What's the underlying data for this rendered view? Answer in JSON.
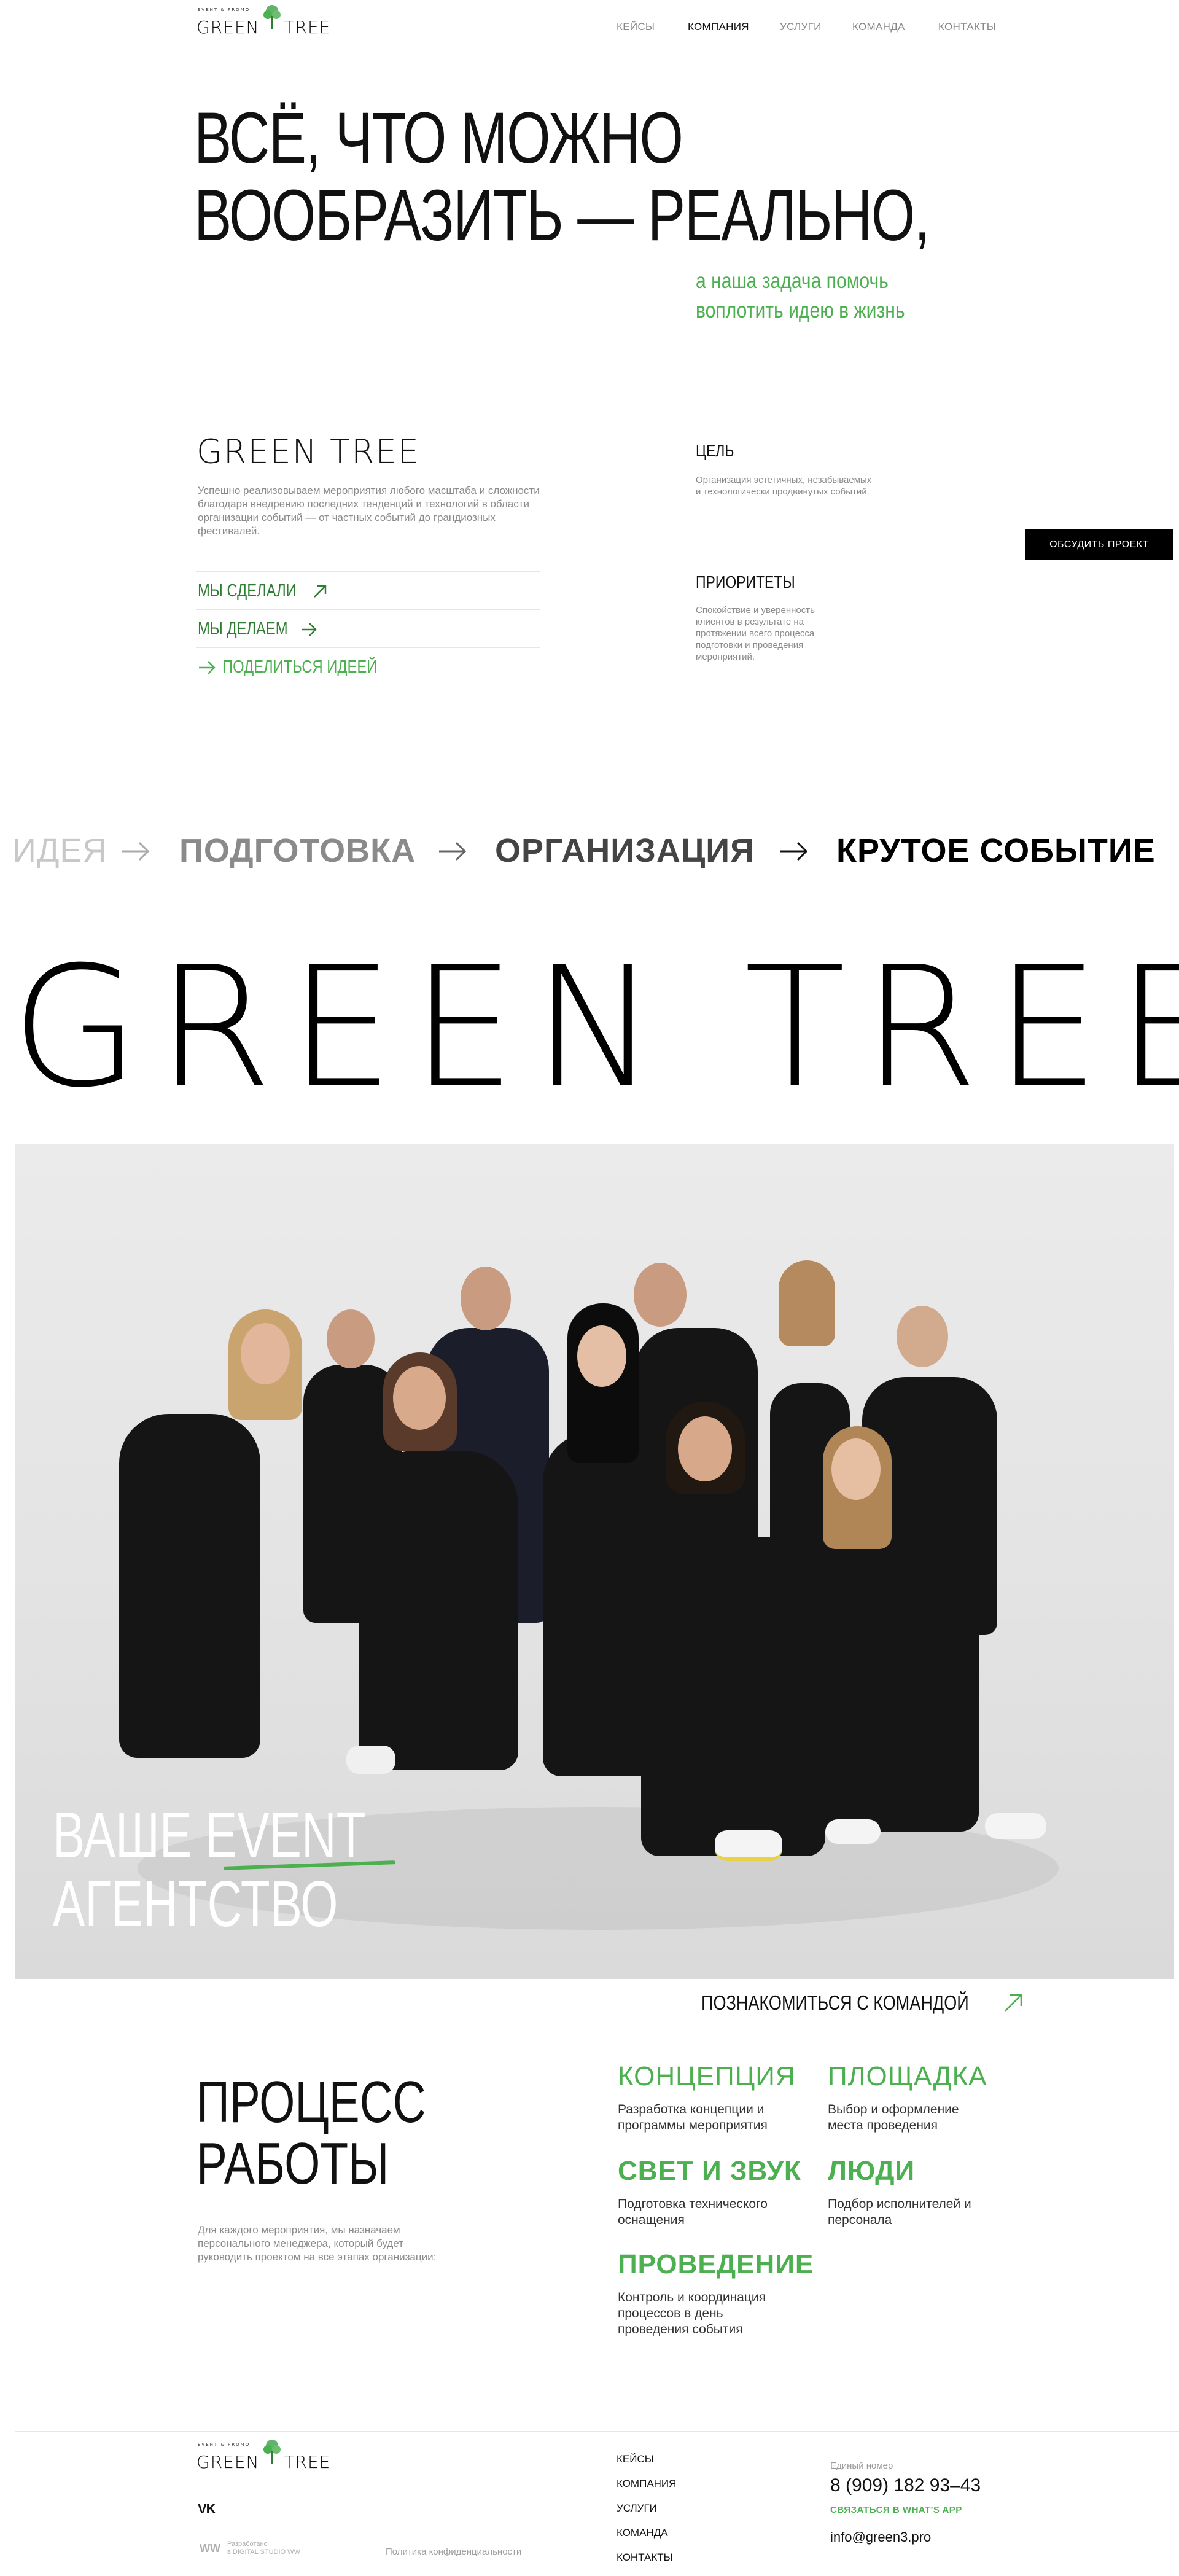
{
  "header": {
    "logo_small": "EVENT & PROMO",
    "logo_text": "GREEN TREE",
    "nav": [
      "КЕЙСЫ",
      "КОМПАНИЯ",
      "УСЛУГИ",
      "КОМАНДА",
      "КОНТАКТЫ"
    ],
    "active_nav": "КОМПАНИЯ"
  },
  "hero": {
    "line1": "ВСЁ, ЧТО МОЖНО",
    "line2": "ВООБРАЗИТЬ — РЕАЛЬНО,",
    "sub1": "а наша задача помочь",
    "sub2": "воплотить идею в жизнь"
  },
  "about": {
    "brand": "GREEN TREE",
    "text": "Успешно реализовываем мероприятия любого масштаба и сложности благодаря внедрению последних тенденций и технологий в области организации событий — от частных событий до грандиозных фестивалей.",
    "links": [
      "МЫ СДЕЛАЛИ",
      "МЫ ДЕЛАЕМ",
      "ПОДЕЛИТЬСЯ ИДЕЕЙ"
    ],
    "goal_title": "ЦЕЛЬ",
    "goal_text": "Организация эстетичных, незабываемых и технологически продвинутых событий.",
    "priority_title": "ПРИОРИТЕТЫ",
    "priority_text": "Спокойствие и уверенность клиентов в результате на протяжении всего процесса подготовки и проведения мероприятий.",
    "cta": "ОБСУДИТЬ ПРОЕКТ"
  },
  "steps": [
    "ИДЕЯ",
    "ПОДГОТОВКА",
    "ОРГАНИЗАЦИЯ",
    "КРУТОЕ СОБЫТИЕ"
  ],
  "brand_big": "GREEN TREE",
  "photo": {
    "caption1": "ВАШЕ EVENT",
    "caption2": "АГЕНТСТВО"
  },
  "team_link": "ПОЗНАКОМИТЬСЯ С КОМАНДОЙ",
  "process": {
    "title1": "ПРОЦЕСС",
    "title2": "РАБОТЫ",
    "text": "Для каждого мероприятия, мы назначаем персонального менеджера, который будет руководить проектом на все этапах организации:",
    "items": [
      {
        "title": "КОНЦЕПЦИЯ",
        "desc": "Разработка концепции и программы мероприятия"
      },
      {
        "title": "ПЛОЩАДКА",
        "desc": "Выбор и оформление места проведения"
      },
      {
        "title": "СВЕТ И ЗВУК",
        "desc": "Подготовка технического оснащения"
      },
      {
        "title": "ЛЮДИ",
        "desc": "Подбор исполнителей и персонала"
      },
      {
        "title": "ПРОВЕДЕНИЕ",
        "desc": "Контроль и координация процессов в день проведения события"
      }
    ]
  },
  "footer": {
    "logo_small": "EVENT & PROMO",
    "logo_text": "GREEN TREE",
    "vk": "VK",
    "dev1": "Разработано",
    "dev2": "в DIGITAL STUDIO WW",
    "dev_logo": "WW",
    "privacy": "Политика конфиденциальности",
    "nav": [
      "КЕЙСЫ",
      "КОМПАНИЯ",
      "УСЛУГИ",
      "КОМАНДА",
      "КОНТАКТЫ"
    ],
    "phone_label": "Единый номер",
    "phone": "8 (909) 182 93–43",
    "whatsapp": "СВЯЗАТЬСЯ В WHAT'S APP",
    "email": "info@green3.pro"
  },
  "colors": {
    "accent": "#4caf50",
    "text": "#111111",
    "muted": "#8a8a8a",
    "button": "#000000"
  }
}
